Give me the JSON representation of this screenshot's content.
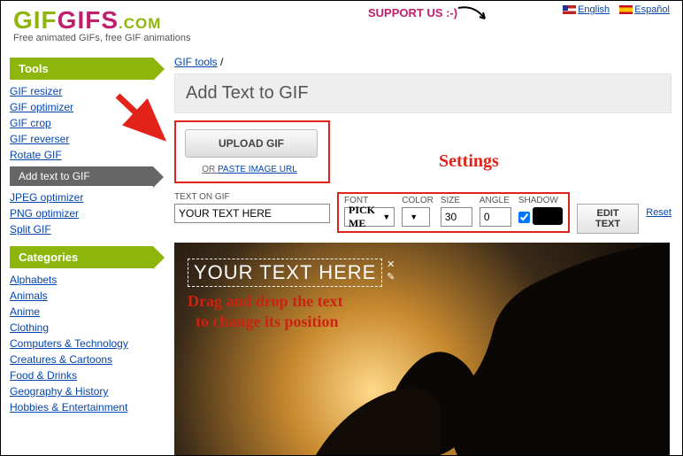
{
  "header": {
    "logo1": "GIF",
    "logo2": "GIFS",
    "logo3": ".COM",
    "tagline": "Free animated GIFs, free GIF animations",
    "support": "SUPPORT US :-)",
    "lang_en": "English",
    "lang_es": "Español"
  },
  "sidebar": {
    "tools_head": "Tools",
    "tools": [
      "GIF resizer",
      "GIF optimizer",
      "GIF crop",
      "GIF reverser",
      "Rotate GIF"
    ],
    "active": "Add text to GIF",
    "tools2": [
      "JPEG optimizer",
      "PNG optimizer",
      "Split GIF"
    ],
    "cats_head": "Categories",
    "cats": [
      "Alphabets",
      "Animals",
      "Anime",
      "Clothing",
      "Computers & Technology",
      "Creatures & Cartoons",
      "Food & Drinks",
      "Geography & History",
      "Hobbies & Entertainment"
    ]
  },
  "main": {
    "crumb": "GIF tools",
    "crumb_sep": "/",
    "title": "Add Text to GIF",
    "upload_btn": "UPLOAD GIF",
    "paste_or": "OR ",
    "paste_link": "PASTE IMAGE URL",
    "text_label": "TEXT ON GIF",
    "text_value": "YOUR TEXT HERE",
    "font_label": "FONT",
    "font_value": "PICK ME",
    "color_label": "COLOR",
    "size_label": "SIZE",
    "size_value": "30",
    "angle_label": "ANGLE",
    "angle_value": "0",
    "shadow_label": "SHADOW",
    "edit_btn": "EDIT TEXT",
    "reset": "Reset",
    "settings_annot": "Settings",
    "overlay_text": "YOUR TEXT HERE",
    "hint_l1": "Drag and drop the text",
    "hint_l2": "to change its position"
  }
}
